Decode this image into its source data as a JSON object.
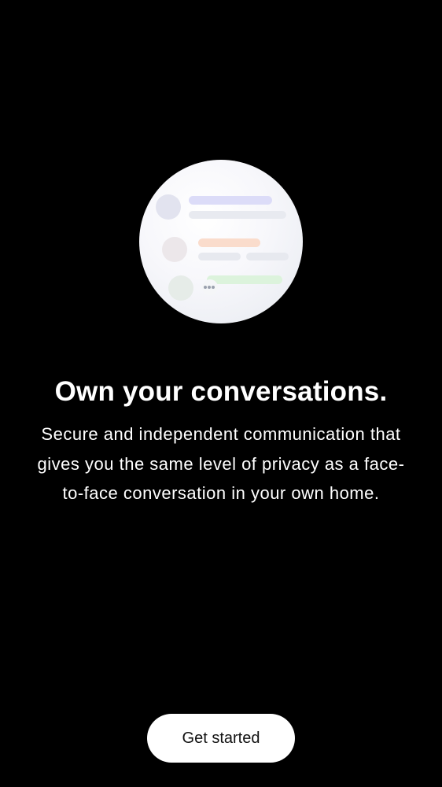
{
  "onboarding": {
    "headline": "Own your conversations.",
    "body": "Secure and independent communication that gives you the same level of privacy as a face-to-face conversation in your own home.",
    "cta_label": "Get started",
    "illustration_icon": "chat-preview-illustration-icon"
  },
  "colors": {
    "background": "#000000",
    "text": "#ffffff",
    "button_background": "#ffffff",
    "button_text": "#111111",
    "accent_purple": "#dcdcf8",
    "accent_orange": "#fadccc",
    "accent_green": "#dcf3dc"
  }
}
